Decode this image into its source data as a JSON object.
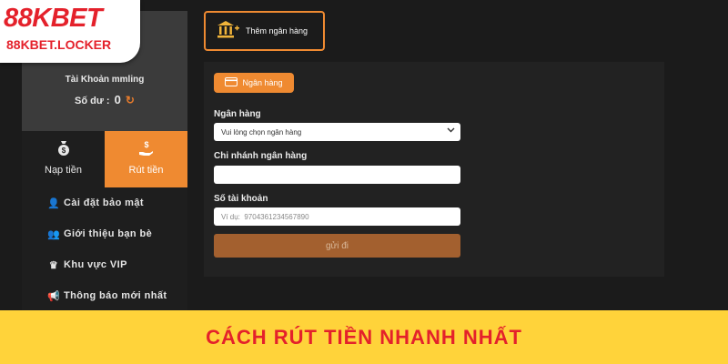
{
  "logo": {
    "main": "88KBET",
    "sub": "88KBET.LOCKER"
  },
  "profile": {
    "username": "Tài Khoản mmling",
    "balance_label": "Số dư :",
    "balance_value": "0"
  },
  "tabs": [
    {
      "label": "Nạp tiền",
      "icon": "money-bag-icon"
    },
    {
      "label": "Rút tiền",
      "icon": "hand-money-icon"
    }
  ],
  "menu": [
    {
      "label": "Cài đặt bảo mật",
      "icon": "user-lock-icon"
    },
    {
      "label": "Giới thiệu bạn bè",
      "icon": "users-icon"
    },
    {
      "label": "Khu vực VIP",
      "icon": "crown-icon"
    },
    {
      "label": "Thông báo mới nhất",
      "icon": "megaphone-icon"
    }
  ],
  "add_bank": {
    "label": "Thêm ngân hàng",
    "icon": "bank-plus-icon"
  },
  "form": {
    "tab_label": "Ngân hàng",
    "bank_label": "Ngân hàng",
    "bank_select_value": "Vui lòng chọn ngân hàng",
    "branch_label": "Chi nhánh ngân hàng",
    "branch_value": "",
    "account_label": "Số tài khoản",
    "account_placeholder": "Ví dụ:  9704361234567890",
    "submit_label": "gửi đi"
  },
  "banner": {
    "text": "CÁCH RÚT TIỀN NHANH NHẤT"
  },
  "colors": {
    "accent": "#ef8a31",
    "panel": "#222222",
    "banner": "#ffd33a",
    "brand_red": "#e4212b",
    "submit": "#a3602f"
  }
}
